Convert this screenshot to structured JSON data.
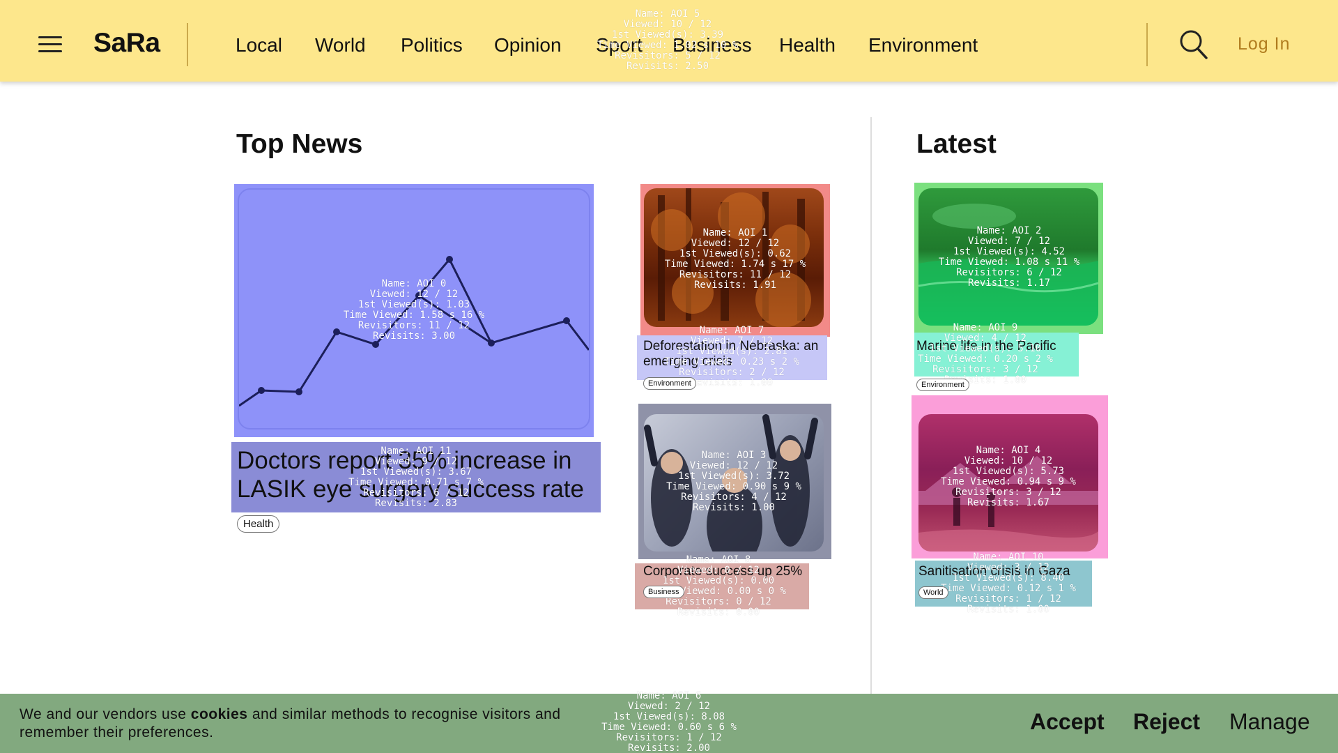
{
  "header": {
    "logo": "SaRa",
    "nav": [
      "Local",
      "World",
      "Politics",
      "Opinion",
      "Sport",
      "Business",
      "Health",
      "Environment"
    ],
    "login": "Log In",
    "icons": [
      "menu-icon",
      "search-icon"
    ]
  },
  "top_news": {
    "title": "Top News",
    "lead": {
      "headline": "Doctors report 35% increase in LASIK eye surgery success rate",
      "tag": "Health"
    },
    "stories": [
      {
        "headline": "Deforestation in Nebraska: an emerging crisis",
        "tag": "Environment"
      },
      {
        "headline": "Corporate success up 25%",
        "tag": "Business"
      }
    ]
  },
  "latest": {
    "title": "Latest",
    "stories": [
      {
        "headline": "Marine life in the Pacific",
        "tag": "Environment"
      },
      {
        "headline": "Sanitisation crisis in Gaza",
        "tag": "World"
      }
    ]
  },
  "cookie": {
    "text_before": "We and our vendors use ",
    "text_bold": "cookies",
    "text_after": " and similar methods to recognise visitors and remember their preferences.",
    "accept": "Accept",
    "reject": "Reject",
    "manage": "Manage"
  },
  "aois": [
    {
      "name": "Name: AOI 0",
      "viewed": "Viewed: 12 / 12",
      "first": "1st Viewed(s): 1.03",
      "time": "Time Viewed: 1.58 s 16 %",
      "revisitors": "Revisitors: 11 / 12",
      "revisits": "Revisits: 3.00",
      "color": "#6b72f7"
    },
    {
      "name": "Name: AOI 1",
      "viewed": "Viewed: 12 / 12",
      "first": "1st Viewed(s): 0.62",
      "time": "Time Viewed: 1.74 s 17 %",
      "revisitors": "Revisitors: 11 / 12",
      "revisits": "Revisits: 1.91",
      "color": "#f25f5c"
    },
    {
      "name": "Name: AOI 2",
      "viewed": "Viewed: 7 / 12",
      "first": "1st Viewed(s): 4.52",
      "time": "Time Viewed: 1.08 s 11 %",
      "revisitors": "Revisitors: 6 / 12",
      "revisits": "Revisits: 1.17",
      "color": "#34d34d"
    },
    {
      "name": "Name: AOI 3",
      "viewed": "Viewed: 12 / 12",
      "first": "1st Viewed(s): 3.72",
      "time": "Time Viewed: 0.90 s 9 %",
      "revisitors": "Revisitors: 4 / 12",
      "revisits": "Revisits: 1.00",
      "color": "#8a8fa4"
    },
    {
      "name": "Name: AOI 4",
      "viewed": "Viewed: 10 / 12",
      "first": "1st Viewed(s): 5.73",
      "time": "Time Viewed: 0.94 s 9 %",
      "revisitors": "Revisitors: 3 / 12",
      "revisits": "Revisits: 1.67",
      "color": "#f76dcf"
    },
    {
      "name": "Name: AOI 5",
      "viewed": "Viewed: 10 / 12",
      "first": "1st Viewed(s): 3.39",
      "time": "Time Viewed: 1.02 s 10 %",
      "revisitors": "Revisitors: 5 / 12",
      "revisits": "Revisits: 2.50",
      "color": "#fde78c"
    },
    {
      "name": "Name: AOI 6",
      "viewed": "Viewed: 2 / 12",
      "first": "1st Viewed(s): 8.08",
      "time": "Time Viewed: 0.60 s 6 %",
      "revisitors": "Revisitors: 1 / 12",
      "revisits": "Revisits: 2.00",
      "color": "#82a97f"
    },
    {
      "name": "Name: AOI 7",
      "viewed": "Viewed: 7 / 12",
      "first": "1st Viewed(s): 2.81",
      "time": "Time Viewed: 0.23 s 2 %",
      "revisitors": "Revisitors: 2 / 12",
      "revisits": "Revisits: 1.00",
      "color": "#b7b9f7"
    },
    {
      "name": "Name: AOI 8",
      "viewed": "Viewed: 0 / 12",
      "first": "1st Viewed(s): 0.00",
      "time": "Time Viewed: 0.00 s 0 %",
      "revisitors": "Revisitors: 0 / 12",
      "revisits": "Revisits: 0.00",
      "color": "#c99a96"
    },
    {
      "name": "Name: AOI 9",
      "viewed": "Viewed: 4 / 12",
      "first": "1st Viewed(s): 5.10",
      "time": "Time Viewed: 0.20 s 2 %",
      "revisitors": "Revisitors: 3 / 12",
      "revisits": "Revisits: 1.00",
      "color": "#7ef0d0"
    },
    {
      "name": "Name: AOI 10",
      "viewed": "Viewed: 3 / 12",
      "first": "1st Viewed(s): 8.40",
      "time": "Time Viewed: 0.12 s 1 %",
      "revisitors": "Revisitors: 1 / 12",
      "revisits": "Revisits: 1.00",
      "color": "#86c3cc"
    },
    {
      "name": "Name: AOI 11",
      "viewed": "Viewed: 9 / 12",
      "first": "1st Viewed(s): 3.67",
      "time": "Time Viewed: 0.71 s 7 %",
      "revisitors": "Revisitors: 6 / 12",
      "revisits": "Revisits: 2.83",
      "color": "#8a8cd6"
    }
  ]
}
